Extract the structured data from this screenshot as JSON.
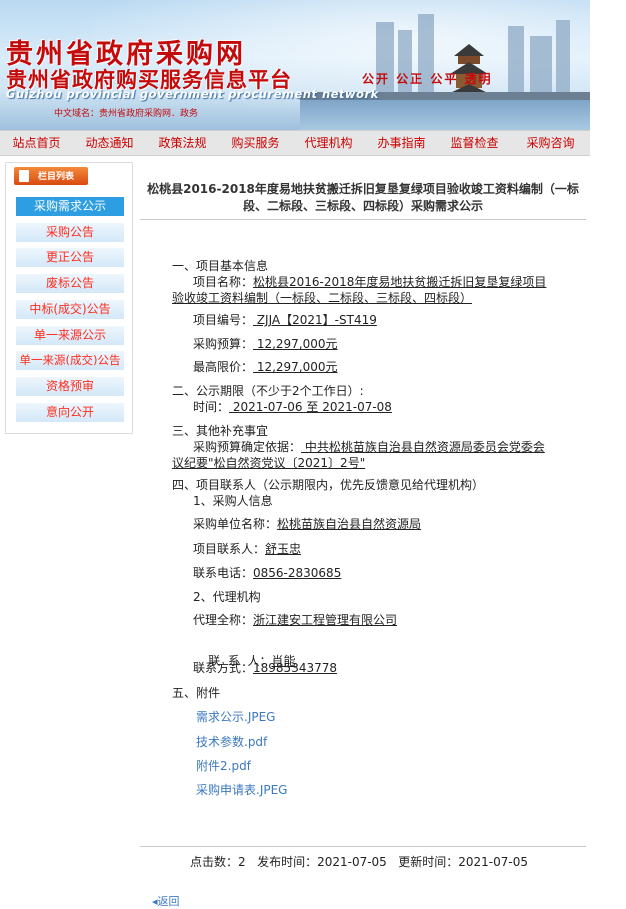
{
  "banner": {
    "title_main": "贵州省政府采购网",
    "title_sub": "贵州省政府购买服务信息平台",
    "title_en": "Guizhou provincial government procurement network",
    "domain_line": "中文域名：贵州省政府采购网．政务",
    "slogan": "公开 公正 公平 透明"
  },
  "nav": {
    "items": [
      "站点首页",
      "动态通知",
      "政策法规",
      "购买服务",
      "代理机构",
      "办事指南",
      "监督检查",
      "采购咨询"
    ]
  },
  "sidebar": {
    "header": "栏目列表",
    "items": [
      "采购需求公示",
      "采购公告",
      "更正公告",
      "废标公告",
      "中标(成交)公告",
      "单一来源公示",
      "单一来源(成交)公告",
      "资格预审",
      "意向公开"
    ]
  },
  "article": {
    "title_line1": "松桃县2016-2018年度易地扶贫搬迁拆旧复垦复绿项目验收竣工资料编制（一标",
    "title_line2": "段、二标段、三标段、四标段）采购需求公示",
    "s1_heading": "一、项目基本信息",
    "name_label": "项目名称：",
    "name_line1": "松桃县2016-2018年度易地扶贫搬迁拆旧复垦复绿项目",
    "name_line2": "验收竣工资料编制（一标段、二标段、三标段、四标段）",
    "code_label": "项目编号：",
    "code_value": " ZJJA【2021】-ST419",
    "budget_label": "采购预算：",
    "budget_value": " 12,297,000元",
    "max_label": "最高限价：",
    "max_value": " 12,297,000元",
    "s2_heading": "二、公示期限（不少于2个工作日）:",
    "time_label": "时间：",
    "time_value": " 2021-07-06 至 2021-07-08",
    "s3_heading": "三、其他补充事宜",
    "basis_label": "采购预算确定依据：",
    "basis_line1": " 中共松桃苗族自治县自然资源局委员会党委会",
    "basis_line2": "议纪要\"松自然资党议〔2021〕2号\"",
    "s4_heading": "四、项目联系人（公示期限内，优先反馈意见给代理机构）",
    "purchaser_heading": "1、采购人信息",
    "unit_label": "采购单位名称：",
    "unit_value": "松桃苗族自治县自然资源局",
    "contact_label": "项目联系人：",
    "contact_value": "舒玉忠",
    "phone_label": "联系电话：",
    "phone_value": "0856-2830685",
    "agency_heading": "2、代理机构",
    "agency_label": "代理全称：",
    "agency_value": "浙江建安工程管理有限公司",
    "agent_label": "联  系  人：",
    "agent_value": "肖能",
    "agent_phone_label": "联系方式：",
    "agent_phone_value": "18985343778",
    "s5_heading": "五、附件",
    "attachments": [
      "需求公示.JPEG",
      "技术参数.pdf",
      "附件2.pdf",
      "采购申请表.JPEG"
    ]
  },
  "footer": {
    "text": "点击数：2   发布时间：2021-07-05   更新时间：2021-07-05",
    "back_link": "◂返回"
  }
}
